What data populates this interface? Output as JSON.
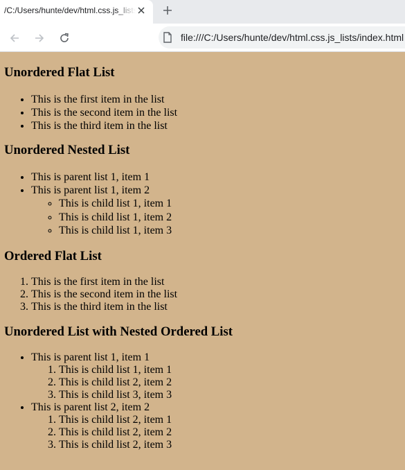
{
  "browser": {
    "tab_title": "/C:/Users/hunte/dev/html.css.js_lists/index.html",
    "url": "file:///C:/Users/hunte/dev/html.css.js_lists/index.html"
  },
  "sections": {
    "s1": {
      "heading": "Unordered Flat List",
      "items": [
        "This is the first item in the list",
        "This is the second item in the list",
        "This is the third item in the list"
      ]
    },
    "s2": {
      "heading": "Unordered Nested List",
      "items": [
        "This is parent list 1, item 1",
        "This is parent list 1, item 2"
      ],
      "child_items": [
        "This is child list 1, item 1",
        "This is child list 1, item 2",
        "This is child list 1, item 3"
      ]
    },
    "s3": {
      "heading": "Ordered Flat List",
      "items": [
        "This is the first item in the list",
        "This is the second item in the list",
        "This is the third item in the list"
      ]
    },
    "s4": {
      "heading": "Unordered List with Nested Ordered List",
      "parent1": "This is parent list 1, item 1",
      "parent1_children": [
        "This is child list 1, item 1",
        "This is child list 2, item 2",
        "This is child list 3, item 3"
      ],
      "parent2": "This is parent list 2, item 2",
      "parent2_children": [
        "This is child list 2, item 1",
        "This is child list 2, item 2",
        "This is child list 2, item 3"
      ]
    }
  }
}
